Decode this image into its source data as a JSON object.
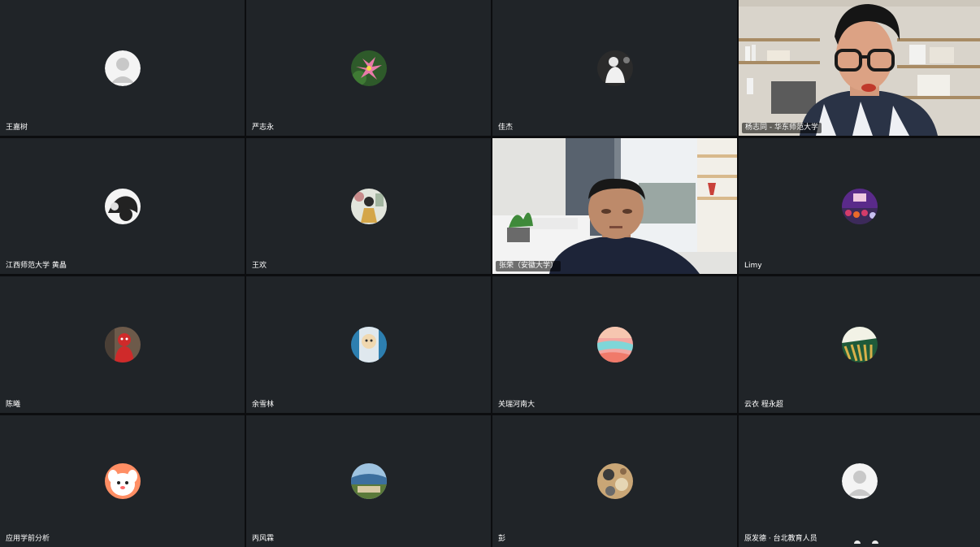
{
  "participants": [
    {
      "name": "王嘉树",
      "avatar_icon": "default-person-icon",
      "avatar_colors": [
        "#f2f2f2",
        "#c7c7c7"
      ]
    },
    {
      "name": "严志永",
      "avatar_icon": "lotus-flower-icon",
      "avatar_colors": [
        "#2e5a2a",
        "#e87aa8"
      ]
    },
    {
      "name": "佳杰",
      "avatar_icon": "person-photo-icon",
      "avatar_colors": [
        "#2b2b2b",
        "#f0f0f0"
      ]
    },
    {
      "name": "杨志同 - 华东师范大学",
      "video": true,
      "speaking": true
    },
    {
      "name": "江西师范大学 黄晶",
      "avatar_icon": "cat-photo-icon",
      "avatar_colors": [
        "#f4f4f4",
        "#222222"
      ]
    },
    {
      "name": "王欢",
      "avatar_icon": "dancer-photo-icon",
      "avatar_colors": [
        "#e2e5dc",
        "#d4a64a"
      ]
    },
    {
      "name": "张荣（安徽大学）",
      "video": true,
      "speaking": false
    },
    {
      "name": "Limy",
      "avatar_icon": "crowd-photo-icon",
      "avatar_colors": [
        "#5a2a8a",
        "#d33c6a"
      ]
    },
    {
      "name": "陈曦",
      "avatar_icon": "red-figure-icon",
      "avatar_colors": [
        "#6d5a4a",
        "#cf2a2a"
      ]
    },
    {
      "name": "余雪林",
      "avatar_icon": "cartoon-photo-icon",
      "avatar_colors": [
        "#2d7fb0",
        "#f0d8b0"
      ]
    },
    {
      "name": "关瑞河南大",
      "avatar_icon": "sunset-sky-icon",
      "avatar_colors": [
        "#f3a6a0",
        "#7fd6d8"
      ]
    },
    {
      "name": "云衣 程永超",
      "avatar_icon": "abstract-pattern-icon",
      "avatar_colors": [
        "#1f5a3a",
        "#f2f2e6"
      ]
    },
    {
      "name": "应用学前分析",
      "avatar_icon": "cartoon-dog-icon",
      "avatar_colors": [
        "#ff8e64",
        "#ffffff"
      ]
    },
    {
      "name": "丙风霖",
      "avatar_icon": "landscape-photo-icon",
      "avatar_colors": [
        "#3c6f9e",
        "#d8caa4"
      ]
    },
    {
      "name": "彭",
      "avatar_icon": "floral-pattern-icon",
      "avatar_colors": [
        "#c9a676",
        "#3b3b3b"
      ]
    },
    {
      "name": "原发德 · 台北教育人员",
      "avatar_icon": "default-person-icon",
      "avatar_colors": [
        "#f2f2f2",
        "#c7c7c7"
      ]
    }
  ],
  "colors": {
    "tile_background": "#202428",
    "speaking_border": "#2ec24a",
    "gap": "#0c0d0f"
  }
}
